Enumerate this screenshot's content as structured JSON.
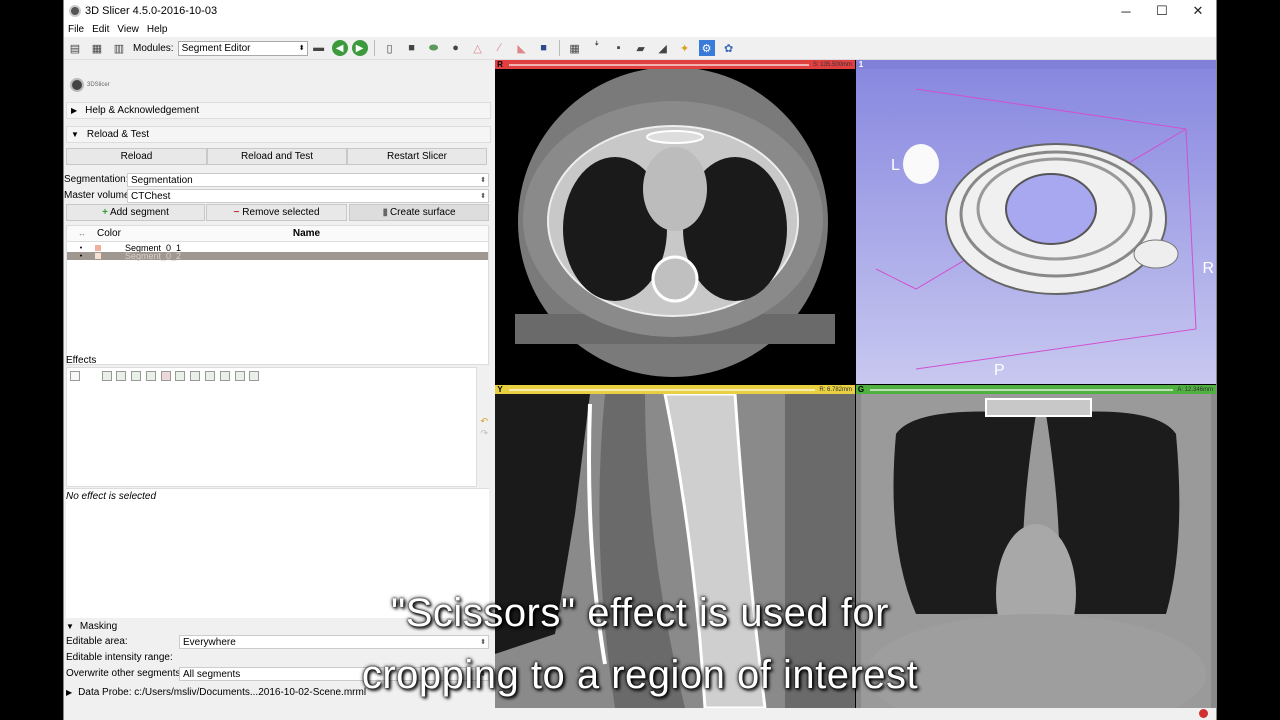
{
  "window": {
    "title": "3D Slicer 4.5.0-2016-10-03",
    "controls": [
      "─",
      "☐",
      "✕"
    ]
  },
  "menu": [
    "File",
    "Edit",
    "View",
    "Help"
  ],
  "toolbar": {
    "modules_label": "Modules:",
    "module_selected": "Segment Editor"
  },
  "panel": {
    "logo_text": "3DSlicer",
    "help_section": "Help & Acknowledgement",
    "reload_section": "Reload & Test",
    "reload_buttons": [
      "Reload",
      "Reload and Test",
      "Restart Slicer"
    ],
    "segmentation_label": "Segmentation:",
    "segmentation_value": "Segmentation",
    "master_label": "Master volume:",
    "master_value": "CTChest",
    "add_segment": "Add segment",
    "remove_selected": "Remove selected",
    "create_surface": "Create surface",
    "table_headers": {
      "color": "Color",
      "name": "Name"
    },
    "segments": [
      "Segment_0_1",
      "Segment_0_2"
    ],
    "effects_label": "Effects",
    "no_effect": "No effect is selected",
    "masking_label": "Masking",
    "editable_area_label": "Editable area:",
    "editable_area_value": "Everywhere",
    "editable_intensity_label": "Editable intensity range:",
    "overwrite_label": "Overwrite other segments:",
    "overwrite_value": "All segments",
    "data_probe": "Data Probe: c:/Users/msliv/Documents...2016-10-02-Scene.mrml"
  },
  "views": {
    "red": {
      "id": "R",
      "value": "S: 135.500mm",
      "color": "#e04040"
    },
    "threed": {
      "id": "1",
      "color": "#8080d8",
      "labels": {
        "left": "L",
        "right": "R",
        "posterior": "P"
      }
    },
    "yellow": {
      "id": "Y",
      "value": "R: 6.782mm",
      "color": "#e8d040"
    },
    "green": {
      "id": "G",
      "value": "A: 12.346mm",
      "color": "#50b040"
    }
  },
  "subtitles": [
    "\"Scissors\" effect is used for",
    "cropping to a region of interest"
  ]
}
